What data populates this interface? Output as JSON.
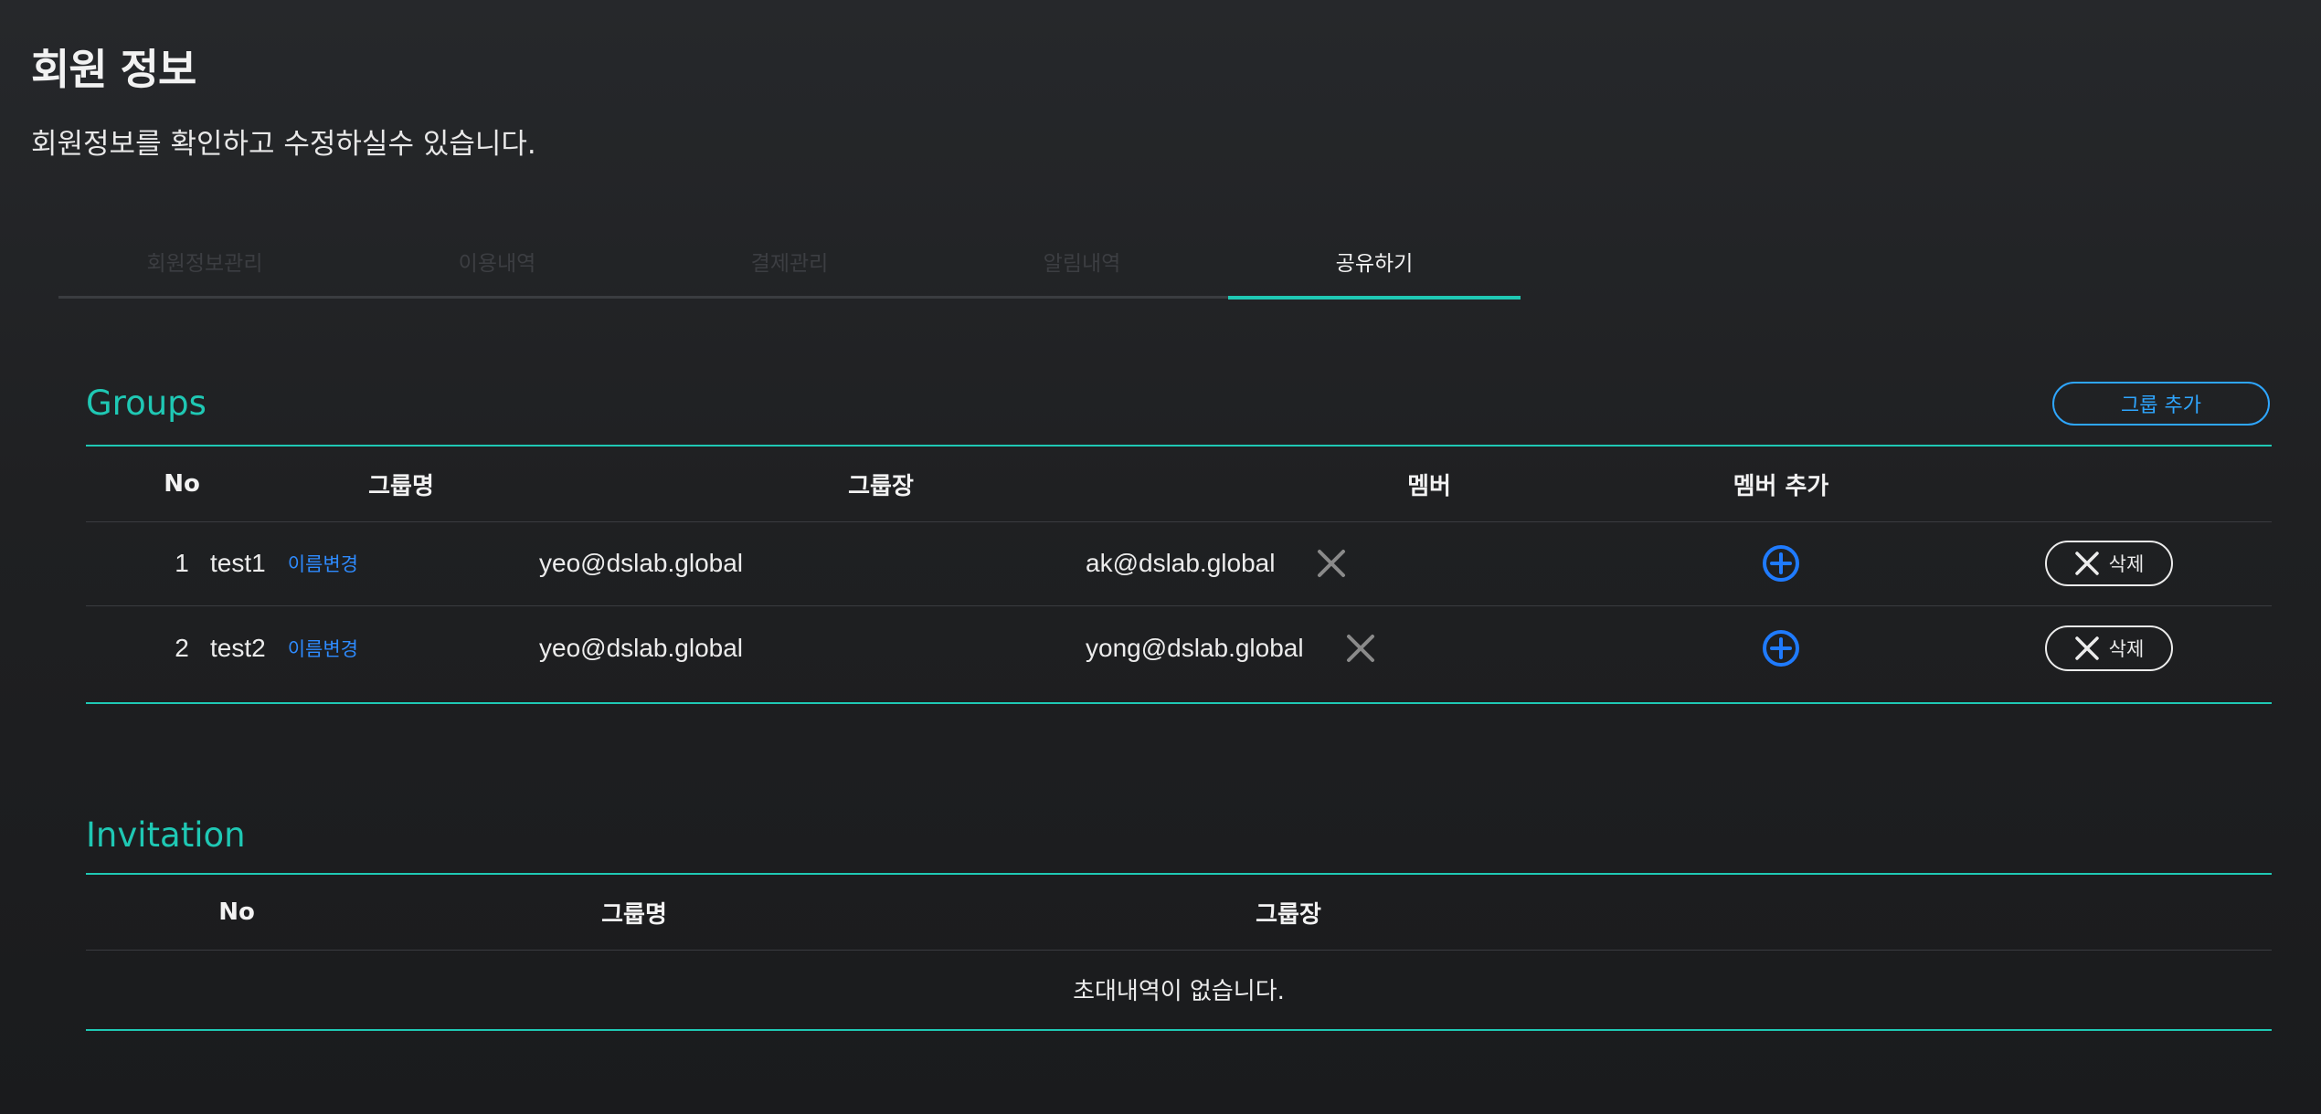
{
  "header": {
    "title": "회원 정보",
    "subtitle": "회원정보를 확인하고 수정하실수 있습니다."
  },
  "tabs": [
    {
      "label": "회원정보관리",
      "active": false
    },
    {
      "label": "이용내역",
      "active": false
    },
    {
      "label": "결제관리",
      "active": false
    },
    {
      "label": "알림내역",
      "active": false
    },
    {
      "label": "공유하기",
      "active": true
    }
  ],
  "groups": {
    "title": "Groups",
    "add_button": "그룹 추가",
    "columns": [
      "No",
      "그룹명",
      "그룹장",
      "멤버",
      "멤버 추가"
    ],
    "rename_label": "이름변경",
    "delete_label": "삭제",
    "rows": [
      {
        "no": "1",
        "name": "test1",
        "leader": "yeo@dslab.global",
        "member": "ak@dslab.global"
      },
      {
        "no": "2",
        "name": "test2",
        "leader": "yeo@dslab.global",
        "member": "yong@dslab.global"
      }
    ]
  },
  "invitation": {
    "title": "Invitation",
    "columns": [
      "No",
      "그룹명",
      "그룹장"
    ],
    "empty_message": "초대내역이 없습니다."
  },
  "colors": {
    "accent": "#1fc8b4",
    "link": "#2e8bff",
    "background": "#1f2022"
  },
  "icons": {
    "remove_member": "close-icon",
    "add_member": "plus-circle-icon",
    "delete": "close-icon"
  }
}
